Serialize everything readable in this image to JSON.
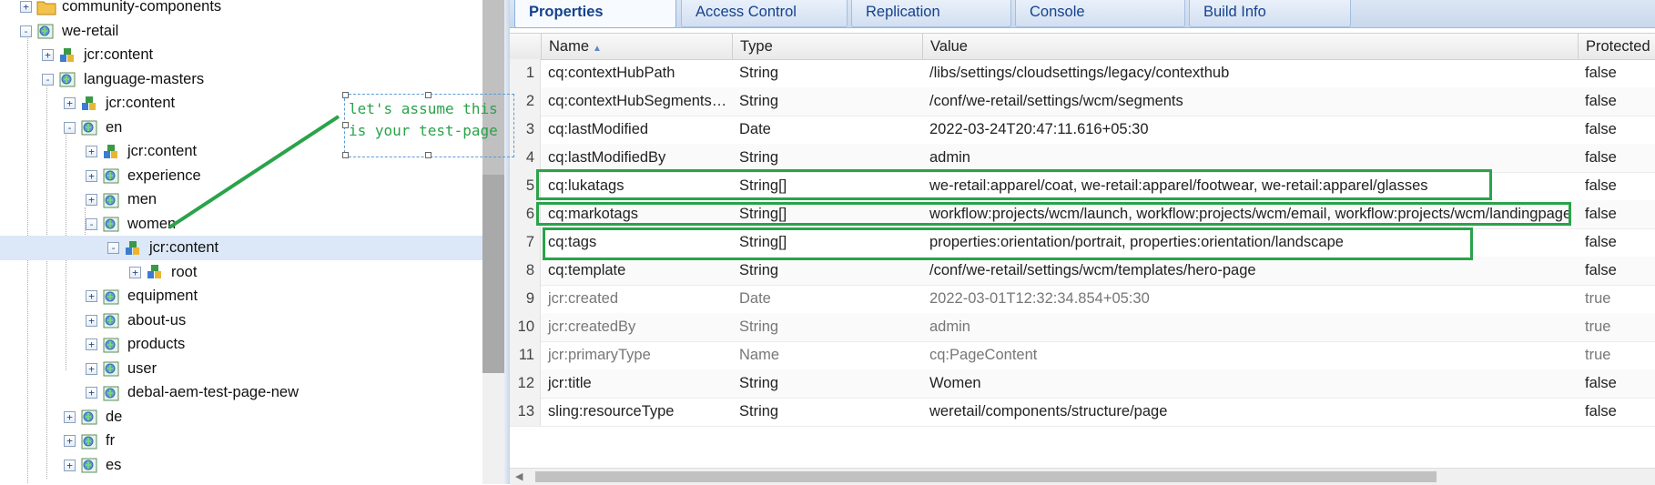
{
  "tree": {
    "nodes": [
      {
        "label": "community-components",
        "icon": "folder-icon",
        "toggle": "+"
      },
      {
        "label": "we-retail",
        "icon": "page-icon",
        "toggle": "-"
      },
      {
        "label": "jcr:content",
        "icon": "content-node-icon",
        "toggle": "+"
      },
      {
        "label": "language-masters",
        "icon": "page-icon",
        "toggle": "-"
      },
      {
        "label": "jcr:content",
        "icon": "content-node-icon",
        "toggle": "+"
      },
      {
        "label": "en",
        "icon": "page-icon",
        "toggle": "-"
      },
      {
        "label": "jcr:content",
        "icon": "content-node-icon",
        "toggle": "+"
      },
      {
        "label": "experience",
        "icon": "page-icon",
        "toggle": "+"
      },
      {
        "label": "men",
        "icon": "page-icon",
        "toggle": "+"
      },
      {
        "label": "women",
        "icon": "page-icon",
        "toggle": "-"
      },
      {
        "label": "jcr:content",
        "icon": "content-node-icon",
        "toggle": "-"
      },
      {
        "label": "root",
        "icon": "content-node-icon",
        "toggle": "+"
      },
      {
        "label": "equipment",
        "icon": "page-icon",
        "toggle": "+"
      },
      {
        "label": "about-us",
        "icon": "page-icon",
        "toggle": "+"
      },
      {
        "label": "products",
        "icon": "page-icon",
        "toggle": "+"
      },
      {
        "label": "user",
        "icon": "page-icon",
        "toggle": "+"
      },
      {
        "label": "debal-aem-test-page-new",
        "icon": "page-icon",
        "toggle": "+"
      },
      {
        "label": "de",
        "icon": "page-icon",
        "toggle": "+"
      },
      {
        "label": "fr",
        "icon": "page-icon",
        "toggle": "+"
      },
      {
        "label": "es",
        "icon": "page-icon",
        "toggle": "+"
      }
    ],
    "selected_index": 10
  },
  "annotation": {
    "line1": "let's assume this",
    "line2": "is your test-page",
    "color": "#2aa34a"
  },
  "tabs": [
    {
      "label": "Properties",
      "active": true
    },
    {
      "label": "Access Control",
      "active": false
    },
    {
      "label": "Replication",
      "active": false
    },
    {
      "label": "Console",
      "active": false
    },
    {
      "label": "Build Info",
      "active": false
    }
  ],
  "grid": {
    "columns": {
      "name": "Name",
      "type": "Type",
      "value": "Value",
      "protected": "Protected"
    },
    "sort_column": "Name",
    "sort_direction": "ascending",
    "rows": [
      {
        "num": "1",
        "name": "cq:contextHubPath",
        "type": "String",
        "value": "/libs/settings/cloudsettings/legacy/contexthub",
        "protected": "false"
      },
      {
        "num": "2",
        "name": "cq:contextHubSegmentsPath",
        "type": "String",
        "value": "/conf/we-retail/settings/wcm/segments",
        "protected": "false"
      },
      {
        "num": "3",
        "name": "cq:lastModified",
        "type": "Date",
        "value": "2022-03-24T20:47:11.616+05:30",
        "protected": "false"
      },
      {
        "num": "4",
        "name": "cq:lastModifiedBy",
        "type": "String",
        "value": "admin",
        "protected": "false"
      },
      {
        "num": "5",
        "name": "cq:lukatags",
        "type": "String[]",
        "value": "we-retail:apparel/coat, we-retail:apparel/footwear, we-retail:apparel/glasses",
        "protected": "false",
        "highlight": true
      },
      {
        "num": "6",
        "name": "cq:markotags",
        "type": "String[]",
        "value": "workflow:projects/wcm/launch, workflow:projects/wcm/email, workflow:projects/wcm/landingpage",
        "protected": "false",
        "highlight": true
      },
      {
        "num": "7",
        "name": "cq:tags",
        "type": "String[]",
        "value": "properties:orientation/portrait, properties:orientation/landscape",
        "protected": "false",
        "highlight": true
      },
      {
        "num": "8",
        "name": "cq:template",
        "type": "String",
        "value": "/conf/we-retail/settings/wcm/templates/hero-page",
        "protected": "false"
      },
      {
        "num": "9",
        "name": "jcr:created",
        "type": "Date",
        "value": "2022-03-01T12:32:34.854+05:30",
        "protected": "true"
      },
      {
        "num": "10",
        "name": "jcr:createdBy",
        "type": "String",
        "value": "admin",
        "protected": "true"
      },
      {
        "num": "11",
        "name": "jcr:primaryType",
        "type": "Name",
        "value": "cq:PageContent",
        "protected": "true"
      },
      {
        "num": "12",
        "name": "jcr:title",
        "type": "String",
        "value": "Women",
        "protected": "false"
      },
      {
        "num": "13",
        "name": "sling:resourceType",
        "type": "String",
        "value": "weretail/components/structure/page",
        "protected": "false"
      }
    ]
  },
  "colors": {
    "highlight": "#2aa34a",
    "tab_text": "#15428b",
    "selected_row": "#dce8f7"
  }
}
